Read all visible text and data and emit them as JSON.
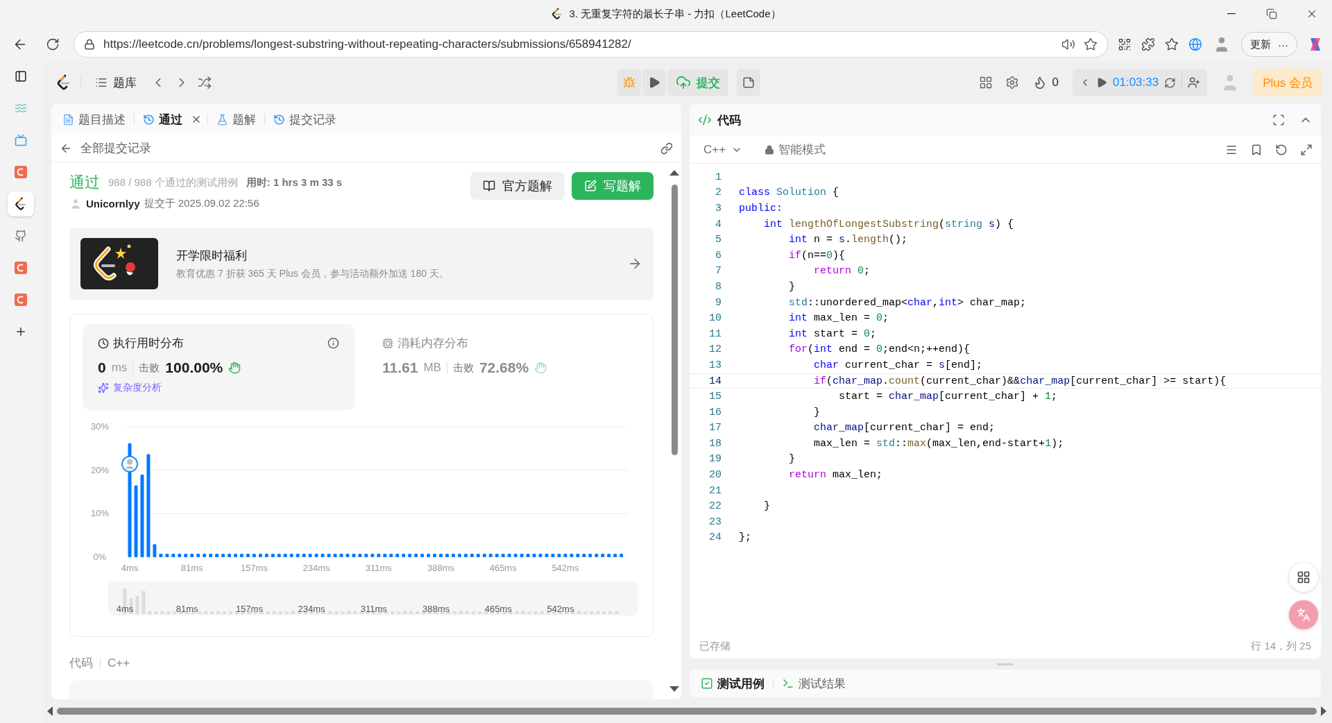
{
  "window": {
    "title": "3. 无重复字符的最长子串 - 力扣（LeetCode）"
  },
  "browser": {
    "url": "https://leetcode.cn/problems/longest-substring-without-repeating-characters/submissions/658941282/",
    "update_button": "更新",
    "menu_button": "···"
  },
  "browser_sidebar": [
    {
      "kind": "tabs",
      "selected": false
    },
    {
      "kind": "wave",
      "selected": false
    },
    {
      "kind": "tv",
      "selected": false
    },
    {
      "kind": "letter",
      "selected": false
    },
    {
      "kind": "leetcode",
      "selected": true
    },
    {
      "kind": "github",
      "selected": false
    },
    {
      "kind": "letter",
      "selected": false
    },
    {
      "kind": "letter",
      "selected": false
    },
    {
      "kind": "add",
      "selected": false
    }
  ],
  "app_toolbar": {
    "problem_list": "题库",
    "submit": "提交",
    "streak": "0",
    "timer": "01:03:33",
    "plus": "Plus 会员"
  },
  "left_tabs": [
    {
      "kind": "description",
      "label": "题目描述",
      "selected": false
    },
    {
      "kind": "history",
      "label": "通过",
      "selected": true,
      "closable": true
    },
    {
      "kind": "solution",
      "label": "题解",
      "selected": false
    },
    {
      "kind": "history",
      "label": "提交记录",
      "selected": false
    }
  ],
  "submission": {
    "back_link": "全部提交记录",
    "status": "通过",
    "testcases": "988 / 988 个通过的测试用例",
    "elapsed": "用时: 1 hrs 3 m 33 s",
    "user": "Unicornlyy",
    "submitted_at": "提交于 2025.09.02 22:56",
    "buttons": [
      {
        "kind": "official",
        "label": "官方题解"
      },
      {
        "kind": "write",
        "label": "写题解"
      }
    ]
  },
  "promo": {
    "title": "开学限时福利",
    "text": "教育优惠 7 折获 365 天 Plus 会员，参与活动额外加送 180 天。"
  },
  "stats": [
    {
      "kind": "time",
      "title": "执行用时分布",
      "value": "0",
      "unit": "ms",
      "beats_label": "击败",
      "beats": "100.00%",
      "selected": true,
      "info_button": true,
      "link": "复杂度分析"
    },
    {
      "kind": "memory",
      "title": "消耗内存分布",
      "value": "11.61",
      "unit": "MB",
      "beats_label": "击败",
      "beats": "72.68%",
      "selected": false
    }
  ],
  "chart_data": {
    "type": "bar",
    "ylim": [
      0,
      30
    ],
    "yticks": [
      {
        "value": 0,
        "label": "0%"
      },
      {
        "value": 10,
        "label": "10%"
      },
      {
        "value": 20,
        "label": "20%"
      },
      {
        "value": 30,
        "label": "30%"
      }
    ],
    "categories": [
      "4ms",
      null,
      null,
      null,
      null,
      null,
      null,
      null,
      null,
      null,
      "81ms",
      null,
      null,
      null,
      null,
      null,
      null,
      null,
      null,
      null,
      "157ms",
      null,
      null,
      null,
      null,
      null,
      null,
      null,
      null,
      null,
      "234ms",
      null,
      null,
      null,
      null,
      null,
      null,
      null,
      null,
      null,
      "311ms",
      null,
      null,
      null,
      null,
      null,
      null,
      null,
      null,
      null,
      "388ms",
      null,
      null,
      null,
      null,
      null,
      null,
      null,
      null,
      null,
      "465ms",
      null,
      null,
      null,
      null,
      null,
      null,
      null,
      null,
      null,
      "542ms",
      null,
      null,
      null,
      null,
      null,
      null,
      null,
      null,
      null
    ],
    "values": [
      26.2,
      16.5,
      19,
      23.7,
      3,
      0.8,
      0.8,
      0.8,
      0.8,
      0.8,
      0.8,
      0.8,
      0.8,
      0.8,
      0.8,
      0.8,
      0.8,
      0.8,
      0.8,
      0.8,
      0.8,
      0.8,
      0.8,
      0.8,
      0.8,
      0.8,
      0.8,
      0.8,
      0.8,
      0.8,
      0.8,
      0.8,
      0.8,
      0.8,
      0.8,
      0.8,
      0.8,
      0.8,
      0.8,
      0.8,
      0.8,
      0.8,
      0.8,
      0.8,
      0.8,
      0.8,
      0.8,
      0.8,
      0.8,
      0.8,
      0.8,
      0.8,
      0.8,
      0.8,
      0.8,
      0.8,
      0.8,
      0.8,
      0.8,
      0.8,
      0.8,
      0.8,
      0.8,
      0.8,
      0.8,
      0.8,
      0.8,
      0.8,
      0.8,
      0.8,
      0.8,
      0.8,
      0.8,
      0.8,
      0.8,
      0.8,
      0.8,
      0.8,
      0.8,
      0.8
    ]
  },
  "navigator_labels": [
    "4ms",
    "81ms",
    "157ms",
    "234ms",
    "311ms",
    "388ms",
    "465ms",
    "542ms"
  ],
  "code_footer": {
    "label": "代码",
    "language": "C++"
  },
  "editor": {
    "title": "代码",
    "language": "C++",
    "mode": "智能模式",
    "saved": "已存储",
    "cursor": "行 14，列 25",
    "lines": [
      {
        "number": "1",
        "selected": false
      },
      {
        "number": "2",
        "selected": false,
        "code": [
          {
            "text": "class",
            "kind": "keyword"
          },
          {
            "text": " Solution",
            "kind": "type"
          },
          {
            "text": " {",
            "kind": "plain"
          }
        ]
      },
      {
        "number": "3",
        "selected": false,
        "code": [
          {
            "text": "public:",
            "kind": "keyword"
          }
        ]
      },
      {
        "number": "4",
        "selected": false,
        "code": [
          {
            "text": "    int",
            "kind": "keyword"
          },
          {
            "text": " lengthOfLongestSubstring",
            "kind": "function"
          },
          {
            "text": "(",
            "kind": "plain"
          },
          {
            "text": "string",
            "kind": "type"
          },
          {
            "text": " s",
            "kind": "variable"
          },
          {
            "text": ") {",
            "kind": "plain"
          }
        ]
      },
      {
        "number": "5",
        "selected": false,
        "code": [
          {
            "text": "        int",
            "kind": "keyword"
          },
          {
            "text": " n = ",
            "kind": "plain"
          },
          {
            "text": "s",
            "kind": "variable"
          },
          {
            "text": ".",
            "kind": "plain"
          },
          {
            "text": "length",
            "kind": "function"
          },
          {
            "text": "();",
            "kind": "plain"
          }
        ]
      },
      {
        "number": "6",
        "selected": false,
        "code": [
          {
            "text": "        if",
            "kind": "control"
          },
          {
            "text": "(n==",
            "kind": "plain"
          },
          {
            "text": "0",
            "kind": "number"
          },
          {
            "text": "){",
            "kind": "plain"
          }
        ]
      },
      {
        "number": "7",
        "selected": false,
        "code": [
          {
            "text": "            return",
            "kind": "control"
          },
          {
            "text": " 0",
            "kind": "number"
          },
          {
            "text": ";",
            "kind": "plain"
          }
        ]
      },
      {
        "number": "8",
        "selected": false,
        "code": [
          {
            "text": "        }",
            "kind": "plain"
          }
        ]
      },
      {
        "number": "9",
        "selected": false,
        "code": [
          {
            "text": "        std",
            "kind": "type"
          },
          {
            "text": "::unordered_map<",
            "kind": "plain"
          },
          {
            "text": "char",
            "kind": "keyword"
          },
          {
            "text": ",",
            "kind": "plain"
          },
          {
            "text": "int",
            "kind": "keyword"
          },
          {
            "text": "> char_map;",
            "kind": "plain"
          }
        ]
      },
      {
        "number": "10",
        "selected": false,
        "code": [
          {
            "text": "        int",
            "kind": "keyword"
          },
          {
            "text": " max_len = ",
            "kind": "plain"
          },
          {
            "text": "0",
            "kind": "number"
          },
          {
            "text": ";",
            "kind": "plain"
          }
        ]
      },
      {
        "number": "11",
        "selected": false,
        "code": [
          {
            "text": "        int",
            "kind": "keyword"
          },
          {
            "text": " start = ",
            "kind": "plain"
          },
          {
            "text": "0",
            "kind": "number"
          },
          {
            "text": ";",
            "kind": "plain"
          }
        ]
      },
      {
        "number": "12",
        "selected": false,
        "code": [
          {
            "text": "        for",
            "kind": "control"
          },
          {
            "text": "(",
            "kind": "plain"
          },
          {
            "text": "int",
            "kind": "keyword"
          },
          {
            "text": " end = ",
            "kind": "plain"
          },
          {
            "text": "0",
            "kind": "number"
          },
          {
            "text": ";end<n;++end){",
            "kind": "plain"
          }
        ]
      },
      {
        "number": "13",
        "selected": false,
        "code": [
          {
            "text": "            char",
            "kind": "keyword"
          },
          {
            "text": " current_char = ",
            "kind": "plain"
          },
          {
            "text": "s",
            "kind": "variable"
          },
          {
            "text": "[end];",
            "kind": "plain"
          }
        ]
      },
      {
        "number": "14",
        "selected": true,
        "code": [
          {
            "text": "            if",
            "kind": "control"
          },
          {
            "text": "(",
            "kind": "plain"
          },
          {
            "text": "char_map",
            "kind": "variable"
          },
          {
            "text": ".",
            "kind": "plain"
          },
          {
            "text": "count",
            "kind": "function"
          },
          {
            "text": "(current_char)&&",
            "kind": "plain"
          },
          {
            "text": "char_map",
            "kind": "variable"
          },
          {
            "text": "[current_char] >= start){",
            "kind": "plain"
          }
        ]
      },
      {
        "number": "15",
        "selected": false,
        "code": [
          {
            "text": "                start = ",
            "kind": "plain"
          },
          {
            "text": "char_map",
            "kind": "variable"
          },
          {
            "text": "[current_char] + ",
            "kind": "plain"
          },
          {
            "text": "1",
            "kind": "number"
          },
          {
            "text": ";",
            "kind": "plain"
          }
        ]
      },
      {
        "number": "16",
        "selected": false,
        "code": [
          {
            "text": "            }",
            "kind": "plain"
          }
        ]
      },
      {
        "number": "17",
        "selected": false,
        "code": [
          {
            "text": "            char_map",
            "kind": "variable"
          },
          {
            "text": "[current_char] = end;",
            "kind": "plain"
          }
        ]
      },
      {
        "number": "18",
        "selected": false,
        "code": [
          {
            "text": "            max_len = ",
            "kind": "plain"
          },
          {
            "text": "std",
            "kind": "type"
          },
          {
            "text": "::",
            "kind": "plain"
          },
          {
            "text": "max",
            "kind": "function"
          },
          {
            "text": "(max_len,end-start+",
            "kind": "plain"
          },
          {
            "text": "1",
            "kind": "number"
          },
          {
            "text": ");",
            "kind": "plain"
          }
        ]
      },
      {
        "number": "19",
        "selected": false,
        "code": [
          {
            "text": "        }",
            "kind": "plain"
          }
        ]
      },
      {
        "number": "20",
        "selected": false,
        "code": [
          {
            "text": "        return",
            "kind": "control"
          },
          {
            "text": " max_len;",
            "kind": "plain"
          }
        ]
      },
      {
        "number": "21",
        "selected": false
      },
      {
        "number": "22",
        "selected": false,
        "code": [
          {
            "text": "    }",
            "kind": "plain"
          }
        ]
      },
      {
        "number": "23",
        "selected": false
      },
      {
        "number": "24",
        "selected": false,
        "code": [
          {
            "text": "};",
            "kind": "plain"
          }
        ]
      }
    ]
  },
  "bottom_tabs": [
    {
      "kind": "testcase",
      "label": "测试用例",
      "selected": true
    },
    {
      "kind": "result",
      "label": "测试结果",
      "selected": false
    }
  ]
}
